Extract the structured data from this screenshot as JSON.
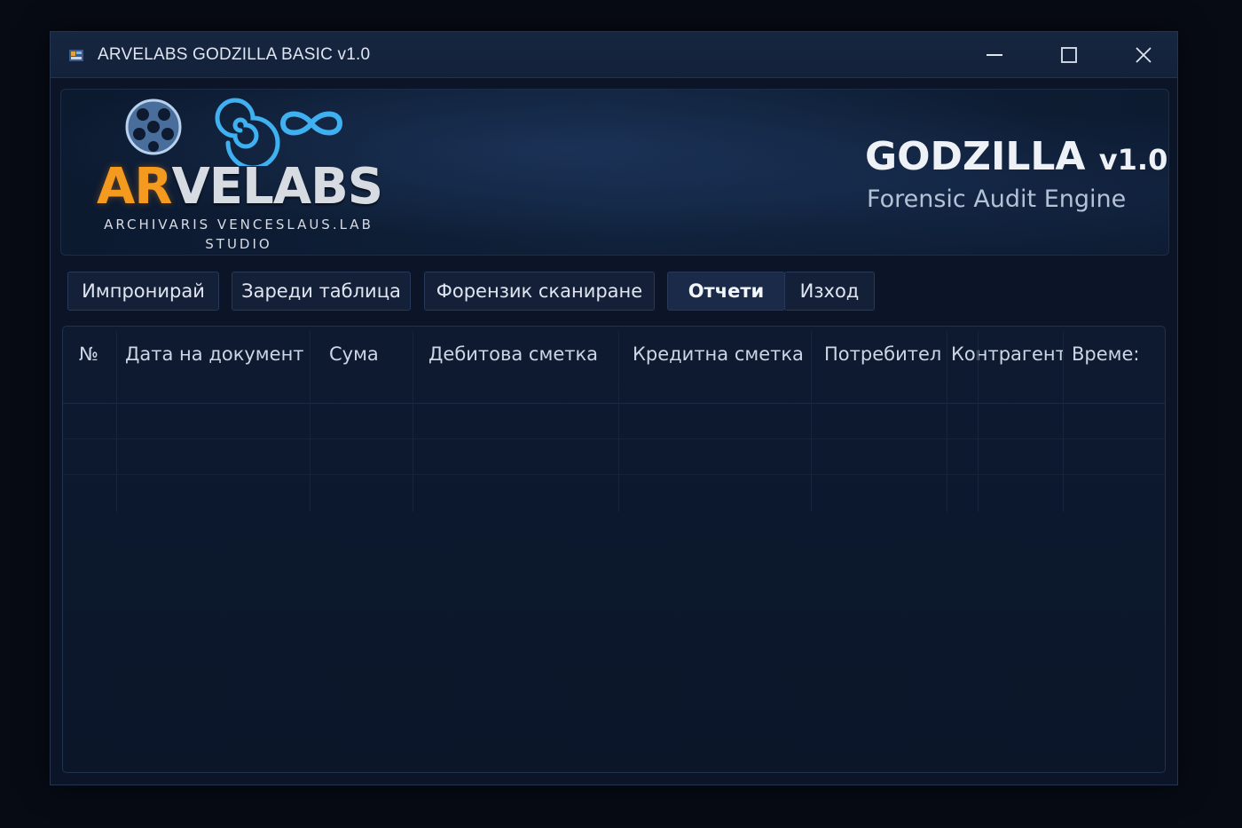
{
  "window": {
    "title": "ARVELABS GODZILLA BASIC v1.0"
  },
  "header": {
    "brand_part1": "AR",
    "brand_part2": "VELABS",
    "brand_subtitle_line1": "ARCHIVARIS VENCESLAUS.LAB",
    "brand_subtitle_line2": "STUDIO",
    "product_name": "GODZILLA",
    "product_version": "v1.0",
    "product_tagline": "Forensic Audit Engine"
  },
  "toolbar": {
    "buttons": [
      {
        "label": "Импронирай"
      },
      {
        "label": "Зареди таблица"
      },
      {
        "label": "Форензик сканиране"
      },
      {
        "label": "Отчети",
        "active": true
      },
      {
        "label": "Изход"
      }
    ]
  },
  "table": {
    "columns": [
      "№",
      "Дата на документ",
      "Сума",
      "Дебитова сметка",
      "Кредитна сметка",
      "Потребител",
      "Контрагент",
      "Време:"
    ],
    "rows": []
  },
  "colors": {
    "accent_orange": "#f39a1f",
    "window_bg": "#0b1527",
    "text_primary": "#dfe6f2"
  },
  "icons": {
    "app": "app-icon",
    "minimize": "minimize-icon",
    "maximize": "maximize-icon",
    "close": "close-icon",
    "logo_film_reel": "film-reel-icon",
    "logo_spiral": "spiral-icon",
    "logo_infinity": "infinity-icon"
  }
}
